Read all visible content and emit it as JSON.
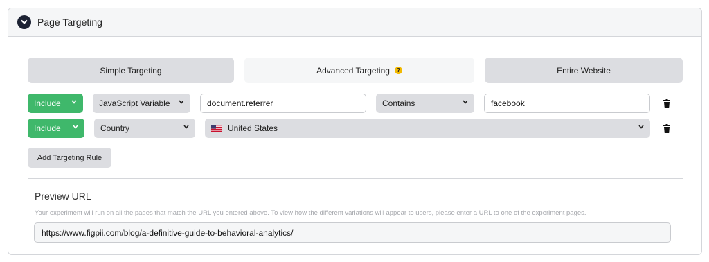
{
  "panel": {
    "title": "Page Targeting",
    "icon": "chevron-down-circle-icon"
  },
  "tabs": [
    {
      "label": "Simple Targeting",
      "active": false
    },
    {
      "label": "Advanced Targeting",
      "active": true,
      "help_icon": "question-icon",
      "help_glyph": "?"
    },
    {
      "label": "Entire Website",
      "active": false
    }
  ],
  "rules": [
    {
      "mode": "Include",
      "type": "JavaScript Variable",
      "variable": "document.referrer",
      "operator": "Contains",
      "value": "facebook",
      "delete_icon": "trash-icon"
    },
    {
      "mode": "Include",
      "type": "Country",
      "country": "United States",
      "country_flag": "us-flag-icon",
      "delete_icon": "trash-icon"
    }
  ],
  "add_rule_label": "Add Targeting Rule",
  "preview": {
    "title": "Preview URL",
    "description": "Your experiment will run on all the pages that match the URL you entered above. To view how the different variations will appear to users, please enter a URL to one of the experiment pages.",
    "url": "https://www.figpii.com/blog/a-definitive-guide-to-behavioral-analytics/"
  },
  "colors": {
    "include_green": "#3fb86b",
    "tab_grey": "#dcdde1",
    "help_yellow": "#f2b900",
    "header_icon": "#1c2233"
  }
}
